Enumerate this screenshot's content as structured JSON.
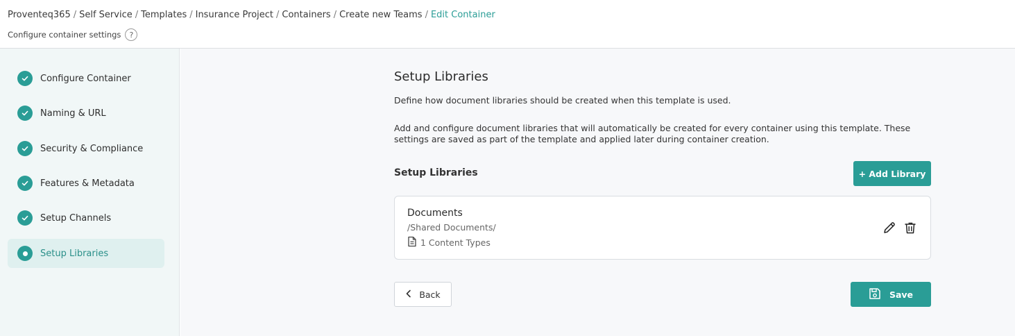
{
  "breadcrumb": {
    "items": [
      "Proventeq365",
      "Self Service",
      "Templates",
      "Insurance Project",
      "Containers",
      "Create new Teams"
    ],
    "current": "Edit Container",
    "separator": "/"
  },
  "header": {
    "subtitle": "Configure container settings",
    "help": "?"
  },
  "sidebar": {
    "steps": [
      {
        "label": "Configure Container",
        "status": "done"
      },
      {
        "label": "Naming & URL",
        "status": "done"
      },
      {
        "label": "Security & Compliance",
        "status": "done"
      },
      {
        "label": "Features & Metadata",
        "status": "done"
      },
      {
        "label": "Setup Channels",
        "status": "done"
      },
      {
        "label": "Setup Libraries",
        "status": "active"
      }
    ]
  },
  "main": {
    "title": "Setup Libraries",
    "description1": "Define how document libraries should be created when this template is used.",
    "description2": "Add and configure document libraries that will automatically be created for every container using this template. These settings are saved as part of the template and applied later during container creation.",
    "section_title": "Setup Libraries",
    "add_button": "+ Add Library",
    "libraries": [
      {
        "name": "Documents",
        "path": "/Shared Documents/",
        "content_types": "1 Content Types"
      }
    ],
    "back_button": "Back",
    "save_button": "Save"
  },
  "colors": {
    "accent": "#2a9d96",
    "sidebar_bg": "#f1f7f7",
    "active_step_bg": "#dff0ef",
    "main_bg": "#f7f8fa"
  },
  "icons": {
    "step_done": "check-icon",
    "step_active": "dot-icon",
    "edit": "pencil-icon",
    "delete": "trash-icon",
    "content_types": "document-icon",
    "back": "chevron-left-icon",
    "save": "floppy-disk-icon"
  }
}
